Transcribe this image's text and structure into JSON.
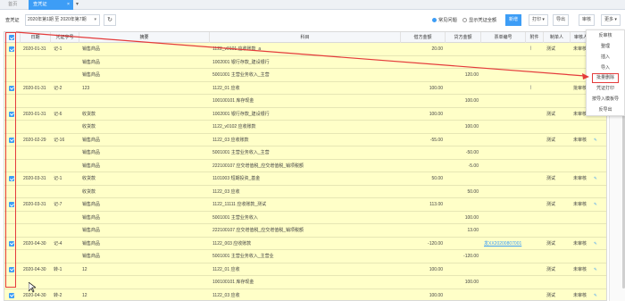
{
  "tabs": {
    "home": "首页",
    "active": "查凭证",
    "close": "×",
    "caret": "▾"
  },
  "toolbar": {
    "label": "查凭证",
    "period": "2020年第1期 至 2020年第7期",
    "refresh_icon": "refresh-icon",
    "option_errors": "常见问题",
    "option_show_all": "显示凭证全额",
    "new_label": "新增",
    "print_label": "打印",
    "export_label": "导出",
    "audit_label": "审核",
    "more_label": "更多"
  },
  "menu": {
    "items": [
      "反审核",
      "整理",
      "插入",
      "导入",
      "批量删除",
      "凭证打印",
      "按导入模板导",
      "反导出"
    ]
  },
  "columns": [
    "日期",
    "凭证字号",
    "摘要",
    "科目",
    "借方金额",
    "贷方金额",
    "票单编号",
    "附件",
    "制单人",
    "审核人"
  ],
  "rows": [
    {
      "checked": true,
      "date": "2020-01-31",
      "no": "记-1",
      "summary": "销售商品",
      "account": "1122_v0101 应收账款_a",
      "debit": "20.00",
      "credit": "",
      "ref": "",
      "attach": true,
      "maker": "测试",
      "auditor": "未审核"
    },
    {
      "checked": false,
      "date": "",
      "no": "",
      "summary": "销售商品",
      "account": "1002001 银行存款_建设银行",
      "debit": "",
      "credit": "",
      "ref": "",
      "attach": false,
      "maker": "",
      "auditor": ""
    },
    {
      "checked": false,
      "date": "",
      "no": "",
      "summary": "销售商品",
      "account": "5001001 主营业务收入_主营",
      "debit": "",
      "credit": "120.00",
      "ref": "",
      "attach": false,
      "maker": "",
      "auditor": ""
    },
    {
      "checked": true,
      "date": "2020-01-31",
      "no": "记-2",
      "summary": "123",
      "account": "1122_01 应收",
      "debit": "100.00",
      "credit": "",
      "ref": "",
      "attach": true,
      "maker": "",
      "auditor": "批审核"
    },
    {
      "checked": false,
      "date": "",
      "no": "",
      "summary": "",
      "account": "100100101 库存现金",
      "debit": "",
      "credit": "100.00",
      "ref": "",
      "attach": false,
      "maker": "",
      "auditor": ""
    },
    {
      "checked": true,
      "date": "2020-01-31",
      "no": "记-6",
      "summary": "收货款",
      "account": "1002001 银行存款_建设银行",
      "debit": "100.00",
      "credit": "",
      "ref": "",
      "attach": false,
      "maker": "测试",
      "auditor": "未审核"
    },
    {
      "checked": false,
      "date": "",
      "no": "",
      "summary": "收货款",
      "account": "1122_v0102 应收账款",
      "debit": "",
      "credit": "100.00",
      "ref": "",
      "attach": false,
      "maker": "",
      "auditor": ""
    },
    {
      "checked": true,
      "date": "2020-02-29",
      "no": "记-16",
      "summary": "销售商品",
      "account": "1122_03 应收账款",
      "debit": "-55.00",
      "credit": "",
      "ref": "",
      "attach": false,
      "maker": "测试",
      "auditor": "未审核"
    },
    {
      "checked": false,
      "date": "",
      "no": "",
      "summary": "销售商品",
      "account": "5001001 主营业务收入_主营",
      "debit": "",
      "credit": "-50.00",
      "ref": "",
      "attach": false,
      "maker": "",
      "auditor": ""
    },
    {
      "checked": false,
      "date": "",
      "no": "",
      "summary": "销售商品",
      "account": "222100107 应交增值税_应交增值税_销项税额",
      "debit": "",
      "credit": "-5.00",
      "ref": "",
      "attach": false,
      "maker": "",
      "auditor": ""
    },
    {
      "checked": true,
      "date": "2020-03-31",
      "no": "记-1",
      "summary": "收货款",
      "account": "1101003 短期投资_基金",
      "debit": "50.00",
      "credit": "",
      "ref": "",
      "attach": false,
      "maker": "测试",
      "auditor": "未审核"
    },
    {
      "checked": false,
      "date": "",
      "no": "",
      "summary": "收货款",
      "account": "1122_03 应收",
      "debit": "",
      "credit": "50.00",
      "ref": "",
      "attach": false,
      "maker": "",
      "auditor": ""
    },
    {
      "checked": true,
      "date": "2020-03-31",
      "no": "记-7",
      "summary": "销售商品",
      "account": "1122_11111 应收账款_测试",
      "debit": "113.00",
      "credit": "",
      "ref": "",
      "attach": false,
      "maker": "测试",
      "auditor": "未审核"
    },
    {
      "checked": false,
      "date": "",
      "no": "",
      "summary": "销售商品",
      "account": "5001001 主营业务收入",
      "debit": "",
      "credit": "100.00",
      "ref": "",
      "attach": false,
      "maker": "",
      "auditor": ""
    },
    {
      "checked": false,
      "date": "",
      "no": "",
      "summary": "销售商品",
      "account": "222100107 应交增值税_应交增值税_销项税额",
      "debit": "",
      "credit": "13.00",
      "ref": "",
      "attach": false,
      "maker": "",
      "auditor": ""
    },
    {
      "checked": true,
      "date": "2020-04-30",
      "no": "记-4",
      "summary": "销售商品",
      "account": "1122_003 应收账款",
      "debit": "-120.00",
      "credit": "",
      "ref": "发XX20200807001",
      "attach": false,
      "maker": "测试",
      "auditor": "未审核"
    },
    {
      "checked": false,
      "date": "",
      "no": "",
      "summary": "销售商品",
      "account": "5001001 主营业务收入_主营业",
      "debit": "",
      "credit": "-120.00",
      "ref": "",
      "attach": false,
      "maker": "",
      "auditor": ""
    },
    {
      "checked": true,
      "date": "2020-04-30",
      "no": "转-1",
      "summary": "12",
      "account": "1122_01 应收",
      "debit": "100.00",
      "credit": "",
      "ref": "",
      "attach": false,
      "maker": "测试",
      "auditor": "未审核"
    },
    {
      "checked": false,
      "date": "",
      "no": "",
      "summary": "",
      "account": "100100101 库存现金",
      "debit": "",
      "credit": "100.00",
      "ref": "",
      "attach": false,
      "maker": "",
      "auditor": ""
    },
    {
      "checked": true,
      "date": "2020-04-30",
      "no": "转-2",
      "summary": "12",
      "account": "1122_03 应收",
      "debit": "100.00",
      "credit": "",
      "ref": "",
      "attach": false,
      "maker": "测试",
      "auditor": "未审核"
    },
    {
      "checked": false,
      "date": "",
      "no": "",
      "summary": "",
      "account": "100100101 库存现金",
      "debit": "",
      "credit": "100.00",
      "ref": "",
      "attach": false,
      "maker": "",
      "auditor": ""
    }
  ],
  "colors": {
    "accent": "#3d9df6",
    "row_highlight": "#ffffc8",
    "annotation_red": "#e43b3b"
  }
}
